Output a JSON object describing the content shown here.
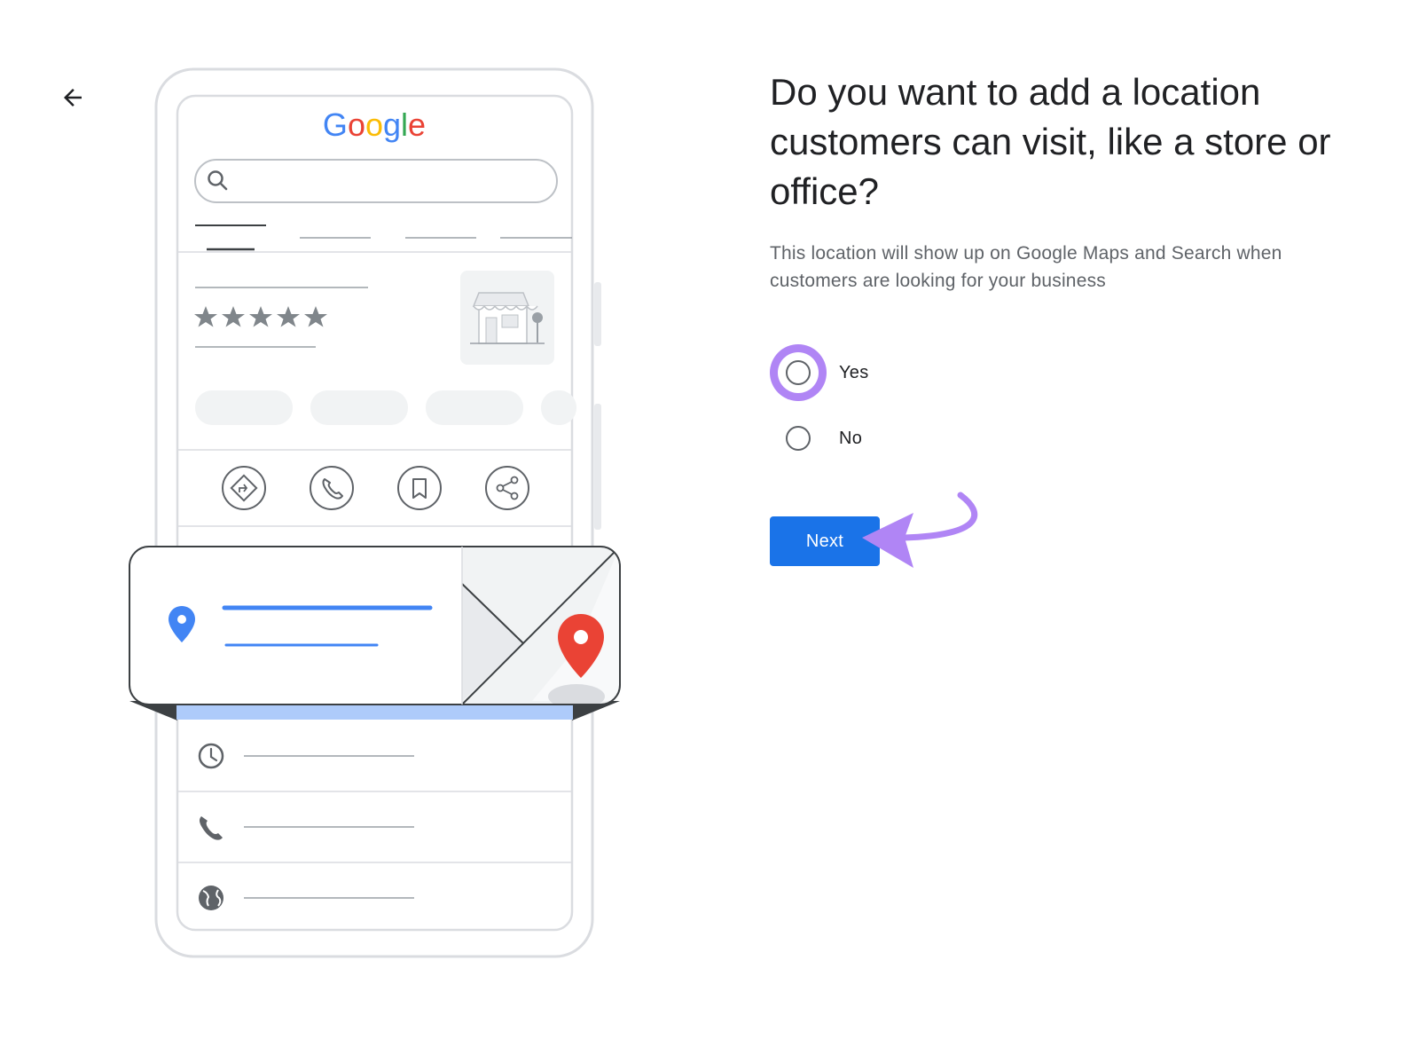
{
  "header": {
    "back_icon": "arrow-left-icon"
  },
  "illustration": {
    "brand": "Google",
    "brand_colors": [
      "#4285F4",
      "#EA4335",
      "#FBBC05",
      "#4285F4",
      "#34A853",
      "#EA4335"
    ],
    "search_icon": "search-icon",
    "rating_stars": 5,
    "action_icons": [
      "directions-icon",
      "phone-icon",
      "bookmark-icon",
      "share-icon"
    ],
    "detail_icons": [
      "clock-icon",
      "phone-icon",
      "globe-icon"
    ],
    "location_pin_color": "#4285F4",
    "map_pin_color": "#EA4335"
  },
  "main": {
    "title": "Do you want to add a location customers can visit, like a store or office?",
    "subtitle": "This location will show up on Google Maps and Search when customers are looking for your business",
    "options": [
      {
        "label": "Yes",
        "highlighted": true,
        "selected": false
      },
      {
        "label": "No",
        "highlighted": false,
        "selected": false
      }
    ],
    "next_label": "Next"
  },
  "colors": {
    "primary": "#1a73e8",
    "annotation": "#b085f5",
    "text_primary": "#202124",
    "text_secondary": "#5f6368"
  }
}
